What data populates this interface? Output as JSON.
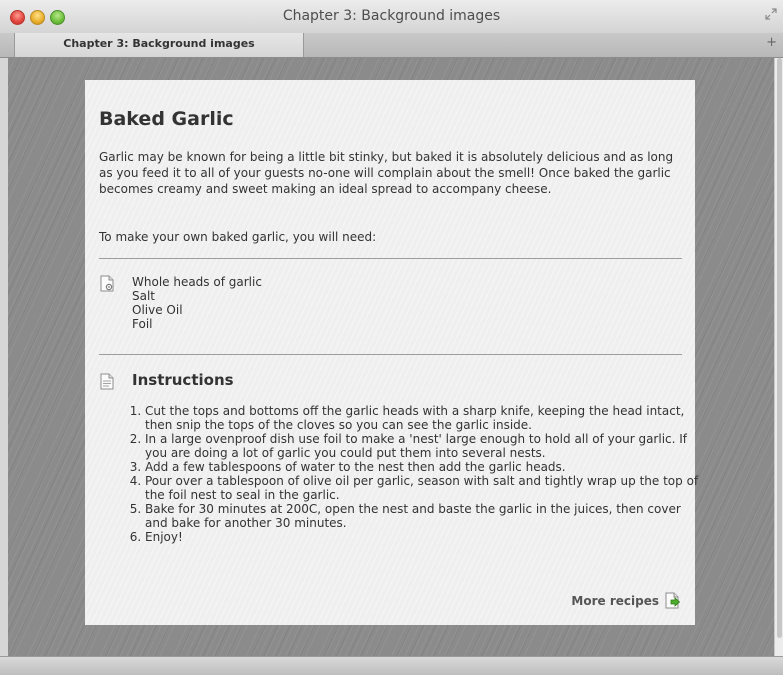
{
  "window": {
    "title": "Chapter 3: Background images"
  },
  "tab": {
    "label": "Chapter 3: Background images"
  },
  "recipe": {
    "title": "Baked Garlic",
    "intro": "Garlic may be known for being a little bit stinky, but baked it is absolutely delicious and as long as you feed it to all of your guests no-one will complain about the smell! Once baked the garlic becomes creamy and sweet making an ideal spread to accompany cheese.",
    "need": "To make your own baked garlic, you will need:",
    "ingredients": [
      "Whole heads of garlic",
      "Salt",
      "Olive Oil",
      "Foil"
    ],
    "instructions_heading": "Instructions",
    "steps": [
      "Cut the tops and bottoms off the garlic heads with a sharp knife, keeping the head intact, then snip the tops of the cloves so you can see the garlic inside.",
      "In a large ovenproof dish use foil to make a 'nest' large enough to hold all of your garlic. If you are doing a lot of garlic you could put them into several nests.",
      "Add a few tablespoons of water to the nest then add the garlic heads.",
      "Pour over a tablespoon of olive oil per garlic, season with salt and tightly wrap up the top of the foil nest to seal in the garlic.",
      "Bake for 30 minutes at 200C, open the nest and baste the garlic in the juices, then cover and bake for another 30 minutes.",
      "Enjoy!"
    ],
    "more_label": "More recipes"
  },
  "icons": {
    "ingredients": "document-gear-icon",
    "instructions": "document-icon",
    "more": "document-arrow-icon"
  }
}
